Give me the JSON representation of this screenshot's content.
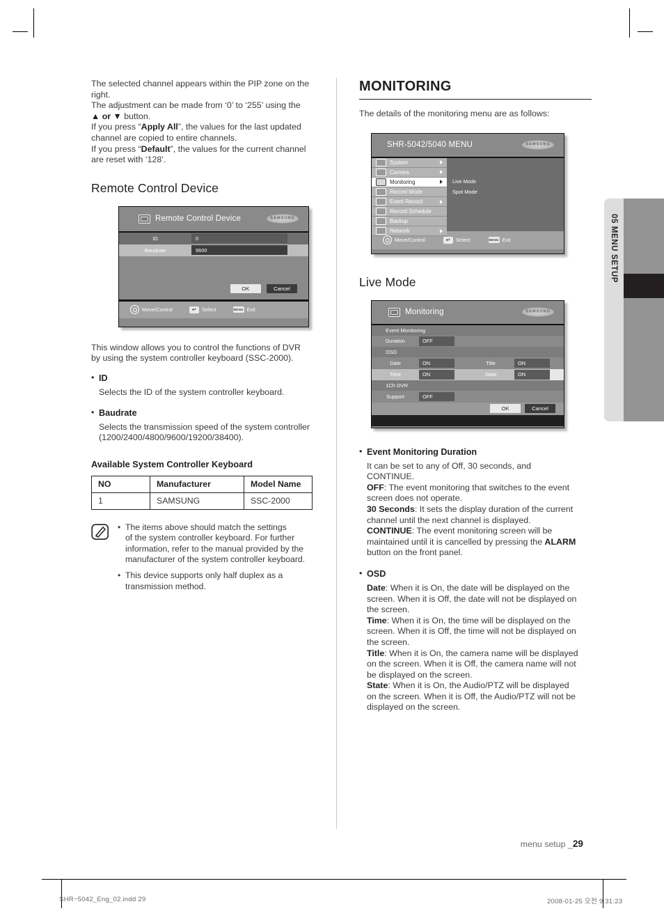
{
  "left_column": {
    "intro_paragraph": "The selected channel appears within the PIP zone on the right.\nThe adjustment can be made from ‘0’ to ‘255’ using the ▲ or ▼ button.\nIf you press “Apply All”, the values for the last updated channel are copied to entire channels.\nIf you press “Default”, the values for the current channel are reset with ‘128’.",
    "intro_lines": {
      "l1": "The selected channel appears within the PIP zone on the",
      "l2": "right.",
      "l3": "The adjustment can be made from ‘0’ to ‘255’ using the",
      "l4_pre": "▲ or ▼",
      "l4_post": " button.",
      "l5_pre": "If you press “",
      "l5_bold": "Apply All",
      "l5_post": "”, the values for the last updated",
      "l6": "channel are copied to entire channels.",
      "l7_pre": "If you press “",
      "l7_bold": "Default",
      "l7_post": "”, the values for the current channel",
      "l8": "are reset with ‘128’."
    },
    "heading": "Remote Control Device",
    "description_l1": "This window allows you to control the functions of DVR",
    "description_l2": "by using the system controller keyboard (SSC-2000).",
    "bullets": [
      {
        "label": "ID",
        "text": "Selects the ID of the system controller keyboard."
      },
      {
        "label": "Baudrate",
        "text_l1": "Selects the transmission speed of the system controller",
        "text_l2": "(1200/2400/4800/9600/19200/38400)."
      }
    ],
    "table_heading": "Available System Controller Keyboard",
    "table": {
      "headers": [
        "NO",
        "Manufacturer",
        "Model Name"
      ],
      "rows": [
        [
          "1",
          "SAMSUNG",
          "SSC-2000"
        ]
      ]
    },
    "note_icon": "note-pencil-icon",
    "notes": [
      "The items above should match the settings of the system controller keyboard. For further information, refer to the manual provided by the manufacturer of the system controller keyboard.",
      "This device supports only half duplex as a transmission method."
    ],
    "note_lines_1": [
      "The items above should match the settings",
      "of the system controller keyboard. For further",
      "information, refer to the manual provided by the",
      "manufacturer of the system controller keyboard."
    ],
    "note_lines_2": [
      "This device supports only half duplex as a",
      "transmission method."
    ]
  },
  "rcd_window": {
    "title": "Remote Control Device",
    "title_icon": "remote-device-icon",
    "brand": "SAMSUNG",
    "rows": [
      {
        "label": "ID",
        "value": "0"
      },
      {
        "label": "Baudrate",
        "value": "9600"
      }
    ],
    "ok_label": "OK",
    "cancel_label": "Cancel",
    "footer": [
      {
        "icon": "jog-dial-icon",
        "label": "Move/Control"
      },
      {
        "icon": "enter-key-icon",
        "glyph": "↵",
        "label": "Select"
      },
      {
        "icon": "menu-key-icon",
        "glyph": "MENU",
        "label": "Exit"
      }
    ]
  },
  "right_column": {
    "section_title": "MONITORING",
    "section_intro": "The details of the monitoring menu are as follows:",
    "sub_title": "Live Mode",
    "bullets": [
      {
        "label": "Event Monitoring Duration",
        "lines": [
          {
            "bold": "",
            "text": "It can be set to any of Off, 30 seconds, and"
          },
          {
            "bold": "",
            "text": "CONTINUE."
          },
          {
            "bold": "OFF",
            "text": ": The event monitoring that switches to the event"
          },
          {
            "bold": "",
            "text": "screen does not operate."
          },
          {
            "bold": "30 Seconds",
            "text": ": It sets the display duration of the current"
          },
          {
            "bold": "",
            "text": "channel until the next channel is displayed."
          },
          {
            "bold": "CONTINUE",
            "text": ": The event monitoring screen will be"
          },
          {
            "bold": "",
            "text": "maintained until it is cancelled by pressing the ",
            "trail_bold": "ALARM"
          },
          {
            "bold": "",
            "text": "button on the front panel."
          }
        ]
      },
      {
        "label": "OSD",
        "lines": [
          {
            "bold": "Date",
            "text": ": When it is On, the date will be displayed on the"
          },
          {
            "bold": "",
            "text": "screen. When it is Off, the date will not be displayed on"
          },
          {
            "bold": "",
            "text": "the screen."
          },
          {
            "bold": "Time",
            "text": ": When it is On, the time will be displayed on the"
          },
          {
            "bold": "",
            "text": "screen. When it is Off, the time will not be displayed on"
          },
          {
            "bold": "",
            "text": "the screen."
          },
          {
            "bold": "Title",
            "text": ": When it is On, the camera name will be displayed"
          },
          {
            "bold": "",
            "text": "on the screen. When it is Off, the camera name will not"
          },
          {
            "bold": "",
            "text": "be displayed on the screen."
          },
          {
            "bold": "State",
            "text": ": When it is On, the Audio/PTZ will be displayed"
          },
          {
            "bold": "",
            "text": "on the screen. When it is Off, the Audio/PTZ will not be"
          },
          {
            "bold": "",
            "text": "displayed on the screen."
          }
        ]
      }
    ]
  },
  "menu_window": {
    "title": "SHR-5042/5040 MENU",
    "brand": "SAMSUNG",
    "items": [
      {
        "label": "System",
        "icon": "system-icon",
        "arrow": true,
        "selected": false
      },
      {
        "label": "Camera",
        "icon": "camera-icon",
        "arrow": true,
        "selected": false
      },
      {
        "label": "Monitoring",
        "icon": "monitoring-icon",
        "arrow": true,
        "selected": true
      },
      {
        "label": "Record Mode",
        "icon": "record-mode-icon",
        "arrow": false,
        "selected": false
      },
      {
        "label": "Event Record",
        "icon": "event-record-icon",
        "arrow": true,
        "selected": false
      },
      {
        "label": "Record Schedule",
        "icon": "record-schedule-icon",
        "arrow": false,
        "selected": false
      },
      {
        "label": "Backup",
        "icon": "backup-icon",
        "arrow": false,
        "selected": false
      },
      {
        "label": "Network",
        "icon": "network-icon",
        "arrow": true,
        "selected": false
      }
    ],
    "submenu": [
      "Live Mode",
      "Spot Mode"
    ],
    "footer": [
      {
        "icon": "jog-dial-icon",
        "label": "Move/Control"
      },
      {
        "icon": "enter-key-icon",
        "glyph": "↵",
        "label": "Select"
      },
      {
        "icon": "menu-key-icon",
        "glyph": "MENU",
        "label": "Exit"
      }
    ]
  },
  "monitoring_window": {
    "title": "Monitoring",
    "title_icon": "monitoring-icon",
    "brand": "SAMSUNG",
    "groups": [
      {
        "name": "Event Monitoring",
        "rows": [
          {
            "cells": [
              {
                "label": "Duration",
                "value": "OFF"
              }
            ],
            "alt": false
          }
        ]
      },
      {
        "name": "OSD",
        "rows": [
          {
            "cells": [
              {
                "label": "Date",
                "value": "ON"
              },
              {
                "label": "Title",
                "value": "ON"
              }
            ],
            "alt": false
          },
          {
            "cells": [
              {
                "label": "Time",
                "value": "ON"
              },
              {
                "label": "State",
                "value": "ON"
              }
            ],
            "alt": true
          }
        ]
      },
      {
        "name": "1Ch DVR",
        "rows": [
          {
            "cells": [
              {
                "label": "Support",
                "value": "OFF"
              }
            ],
            "alt": false
          }
        ]
      }
    ],
    "ok_label": "OK",
    "cancel_label": "Cancel"
  },
  "thumb_tab": {
    "label": "05 MENU SETUP"
  },
  "footer": {
    "page_label": "menu setup _",
    "page_number": "29",
    "print_left": "SHR−5042_Eng_02.indd   29",
    "print_right": "2008-01-25   오전 9:31:23"
  }
}
